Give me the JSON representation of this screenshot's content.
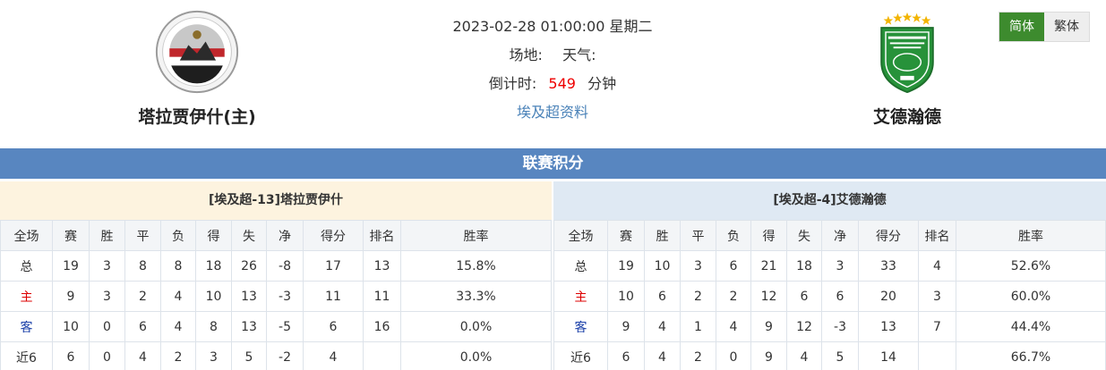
{
  "header": {
    "datetime": "2023-02-28 01:00:00 星期二",
    "venue_label": "场地:",
    "weather_label": "天气:",
    "countdown_label": "倒计时:",
    "countdown_value": "549",
    "countdown_unit": "分钟",
    "league_link": "埃及超资料"
  },
  "home_team": {
    "name": "塔拉贾伊什(主)",
    "logo_icon": "el-geish-crest-logo"
  },
  "away_team": {
    "name": "艾德瀚德",
    "logo_icon": "alittihad-alexandria-crest-logo"
  },
  "language": {
    "simplified": "简体",
    "traditional": "繁体"
  },
  "standings": {
    "title": "联赛积分",
    "columns": [
      "全场",
      "赛",
      "胜",
      "平",
      "负",
      "得",
      "失",
      "净",
      "得分",
      "排名",
      "胜率"
    ],
    "home": {
      "title": "[埃及超-13]塔拉贾伊什",
      "rows": [
        [
          "总",
          "19",
          "3",
          "8",
          "8",
          "18",
          "26",
          "-8",
          "17",
          "13",
          "15.8%"
        ],
        [
          "主",
          "9",
          "3",
          "2",
          "4",
          "10",
          "13",
          "-3",
          "11",
          "11",
          "33.3%"
        ],
        [
          "客",
          "10",
          "0",
          "6",
          "4",
          "8",
          "13",
          "-5",
          "6",
          "16",
          "0.0%"
        ],
        [
          "近6",
          "6",
          "0",
          "4",
          "2",
          "3",
          "5",
          "-2",
          "4",
          "",
          "0.0%"
        ]
      ]
    },
    "away": {
      "title": "[埃及超-4]艾德瀚德",
      "rows": [
        [
          "总",
          "19",
          "10",
          "3",
          "6",
          "21",
          "18",
          "3",
          "33",
          "4",
          "52.6%"
        ],
        [
          "主",
          "10",
          "6",
          "2",
          "2",
          "12",
          "6",
          "6",
          "20",
          "3",
          "60.0%"
        ],
        [
          "客",
          "9",
          "4",
          "1",
          "4",
          "9",
          "12",
          "-3",
          "13",
          "7",
          "44.4%"
        ],
        [
          "近6",
          "6",
          "4",
          "2",
          "0",
          "9",
          "4",
          "5",
          "14",
          "",
          "66.7%"
        ]
      ]
    }
  },
  "colors": {
    "banner": "#5886c0",
    "accent_green": "#3d8b2e",
    "countdown_red": "#e00000",
    "link_blue": "#4a82b8",
    "home_label_red": "#d00000",
    "away_label_blue": "#1a3fa8"
  }
}
